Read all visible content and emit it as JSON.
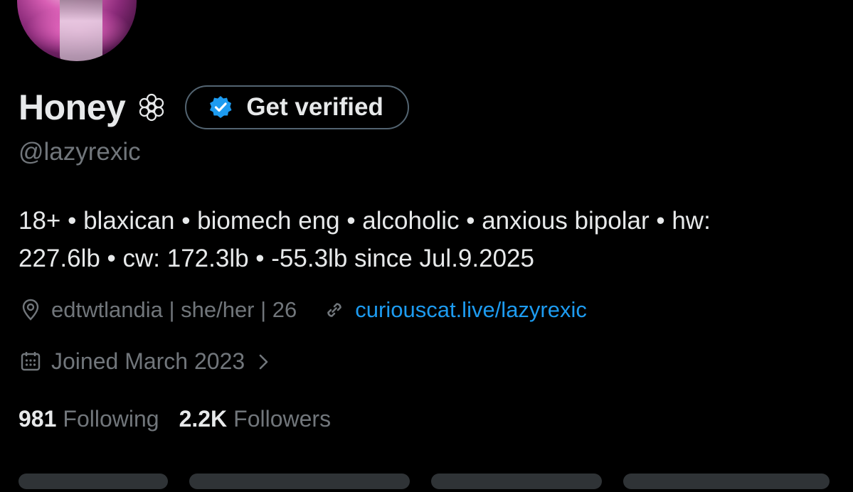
{
  "profile": {
    "display_name": "Honey",
    "affiliation_icon": "flower-icon",
    "verify_button_label": "Get verified",
    "handle": "@lazyrexic",
    "bio_line_1": "18+ • blaxican • biomech eng • alcoholic • anxious bipolar • hw:",
    "bio_line_2": "227.6lb • cw: 172.3lb • -55.3lb since Jul.9.2025",
    "location": "edtwtlandia | she/her | 26",
    "website": "curiouscat.live/lazyrexic",
    "joined": "Joined March 2023",
    "following_count": "981",
    "following_label": "Following",
    "followers_count": "2.2K",
    "followers_label": "Followers"
  },
  "colors": {
    "background": "#000000",
    "primary_text": "#e7e9ea",
    "secondary_text": "#71767b",
    "link": "#1d9bf0",
    "verified_blue": "#1d9bf0",
    "button_border": "#536471"
  },
  "icons": {
    "location": "location-pin-icon",
    "link": "link-icon",
    "calendar": "calendar-icon",
    "chevron": "chevron-right-icon",
    "verified": "verified-badge-icon"
  }
}
